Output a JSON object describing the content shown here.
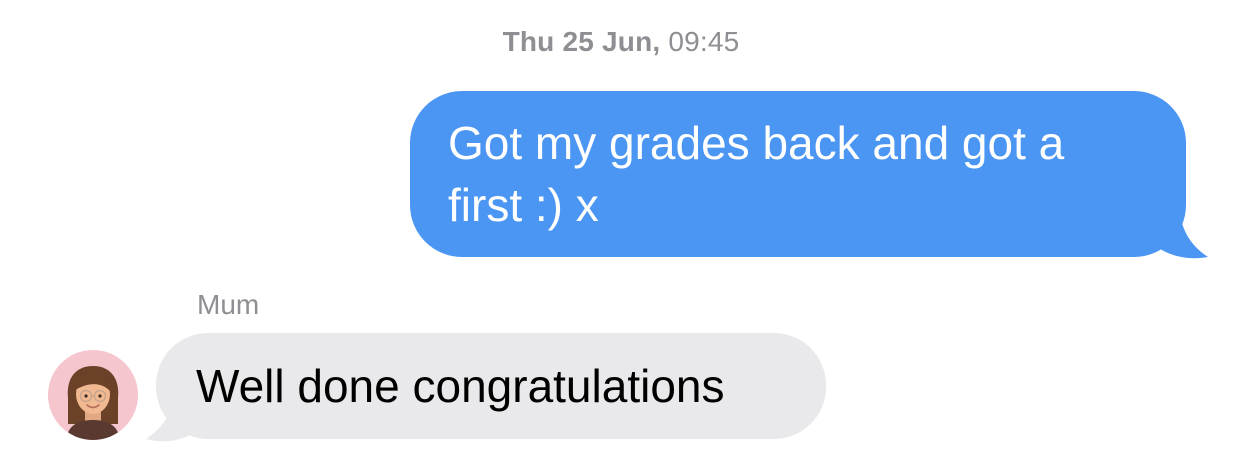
{
  "conversation": {
    "timestamp_day": "Thu 25 Jun,",
    "timestamp_time": "09:45",
    "messages": [
      {
        "direction": "outgoing",
        "line1": "Got my grades back and got a",
        "line2": "first :) x",
        "color": "#4c96f3"
      },
      {
        "direction": "incoming",
        "sender": "Mum",
        "text": "Well done congratulations",
        "color": "#e9e9eb"
      }
    ],
    "avatar": {
      "icon": "memoji-avatar-icon",
      "background": "#f6c6cf"
    }
  }
}
